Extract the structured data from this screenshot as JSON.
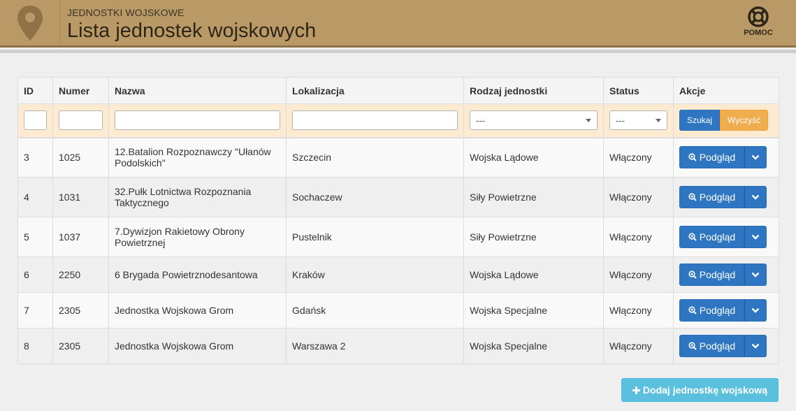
{
  "header": {
    "subtitle": "JEDNOSTKI WOJSKOWE",
    "title": "Lista jednostek wojskowych",
    "help_label": "POMOC",
    "logo_icon": "map-marker-icon",
    "help_icon": "lifebuoy-icon"
  },
  "table": {
    "columns": [
      "ID",
      "Numer",
      "Nazwa",
      "Lokalizacja",
      "Rodzaj jednostki",
      "Status",
      "Akcje"
    ],
    "filter": {
      "rodzaj_selected": "---",
      "status_selected": "---",
      "search_label": "Szukaj",
      "clear_label": "Wyczyść"
    },
    "rows": [
      {
        "id": "3",
        "numer": "1025",
        "nazwa": "12.Batalion Rozpoznawczy \"Ułanów Podolskich\"",
        "lokalizacja": "Szczecin",
        "rodzaj": "Wojska Lądowe",
        "status": "Włączony"
      },
      {
        "id": "4",
        "numer": "1031",
        "nazwa": "32.Pułk Lotnictwa Rozpoznania Taktycznego",
        "lokalizacja": "Sochaczew",
        "rodzaj": "Siły Powietrzne",
        "status": "Włączony"
      },
      {
        "id": "5",
        "numer": "1037",
        "nazwa": "7.Dywizjon Rakietowy Obrony Powietrznej",
        "lokalizacja": "Pustelnik",
        "rodzaj": "Siły Powietrzne",
        "status": "Włączony"
      },
      {
        "id": "6",
        "numer": "2250",
        "nazwa": "6 Brygada Powietrznodesantowa",
        "lokalizacja": "Kraków",
        "rodzaj": "Wojska Lądowe",
        "status": "Włączony"
      },
      {
        "id": "7",
        "numer": "2305",
        "nazwa": "Jednostka Wojskowa Grom",
        "lokalizacja": "Gdańsk",
        "rodzaj": "Wojska Specjalne",
        "status": "Włączony"
      },
      {
        "id": "8",
        "numer": "2305",
        "nazwa": "Jednostka Wojskowa Grom",
        "lokalizacja": "Warszawa 2",
        "rodzaj": "Wojska Specjalne",
        "status": "Włączony"
      }
    ],
    "view_label": "Podgląd"
  },
  "add_button_label": "Dodaj jednostkę wojskową",
  "colors": {
    "header_bg": "#b99a66",
    "primary": "#2e76c2",
    "warning": "#f0ad4e",
    "info": "#5bc0de",
    "status_ok": "#3c8f2f"
  }
}
